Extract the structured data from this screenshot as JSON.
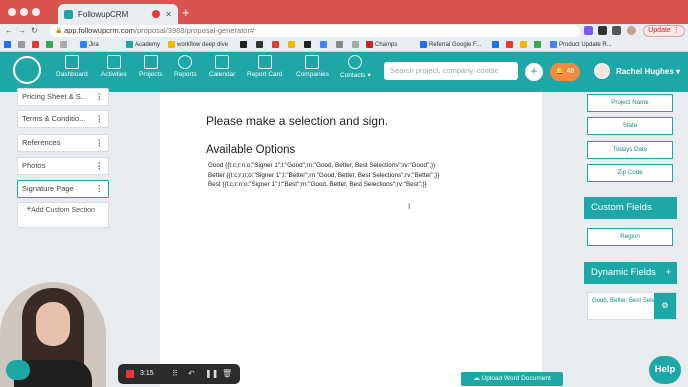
{
  "browser": {
    "tab_title": "FollowupCRM",
    "url_host": "app.followupcrm.com",
    "url_path": "/proposal/3988/proposal-generator#",
    "update_label": "Update",
    "bookmarks": [
      "Jira",
      "Academy",
      "workflow deep dive",
      "Champs",
      "Referral Google F...",
      "Product Update R..."
    ]
  },
  "header": {
    "nav": [
      "Dashboard",
      "Activities",
      "Projects",
      "Reports",
      "Calendar",
      "Report Card",
      "Companies",
      "Contacts"
    ],
    "search_placeholder": "Search project, company, contac",
    "notification_count": "48",
    "user_name": "Rachel Hughes"
  },
  "left_sidebar": {
    "sections": [
      "Pricing Sheet & S...",
      "Terms & Conditio...",
      "References",
      "Photos",
      "Signature Page"
    ],
    "add_custom_label": "Add Custom Section"
  },
  "document": {
    "title": "Please make a selection and sign.",
    "subtitle": "Available Options",
    "options": [
      "Good {{t:c;r:n;o:\"Signer 1\";l:\"Good\";rn:\"Good, Better, Best Selections\";rv:\"Good\";}}",
      "Better {{t:c;r:n;o:\"Signer 1\";l:\"Better\";rn:\"Good, Better, Best Selections\";rv:\"Better\";}}",
      "Best {{t:c;r:n;o:\"Signer 1\";l:\"Best\";rn:\"Good, Better, Best Selections\";rv:\"Best\";}}"
    ]
  },
  "right_panel": {
    "fields": [
      "Project Name",
      "State",
      "Todays Date",
      "Zip Code"
    ],
    "custom_fields_heading": "Custom Fields",
    "custom_fields": [
      "Region"
    ],
    "dynamic_fields_heading": "Dynamic Fields",
    "dynamic_item": "Good, Better, Best Selections"
  },
  "recording": {
    "time": "3:15"
  },
  "upload_label": "Upload Word Document",
  "help_label": "Help",
  "colors": {
    "brand": "#1ea7a7",
    "chrome_tab_bar": "#d9534f",
    "notification": "#f08a3c"
  }
}
